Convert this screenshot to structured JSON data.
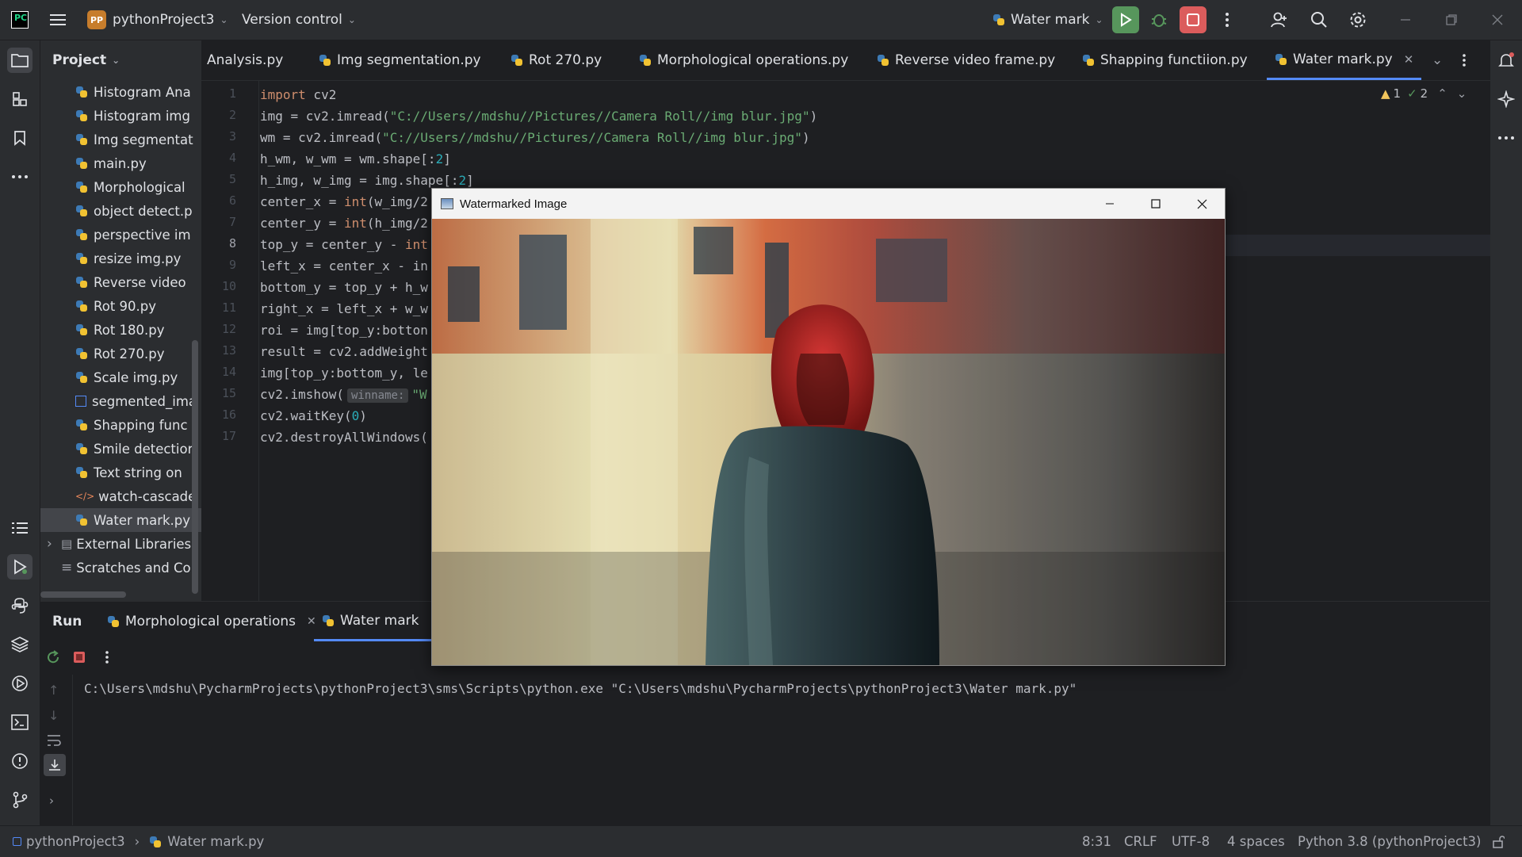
{
  "titlebar": {
    "project_badge": "PP",
    "project_name": "pythonProject3",
    "vcs": "Version control",
    "run_config": "Water mark"
  },
  "project_panel": {
    "title": "Project",
    "items": [
      {
        "label": "Histogram Ana",
        "icon": "python-file-icon"
      },
      {
        "label": "Histogram img",
        "icon": "python-file-icon"
      },
      {
        "label": "Img segmentat",
        "icon": "python-file-icon"
      },
      {
        "label": "main.py",
        "icon": "python-file-icon"
      },
      {
        "label": "Morphological",
        "icon": "python-file-icon"
      },
      {
        "label": "object detect.p",
        "icon": "python-file-icon"
      },
      {
        "label": "perspective im",
        "icon": "python-file-icon"
      },
      {
        "label": "resize img.py",
        "icon": "python-file-icon"
      },
      {
        "label": "Reverse video",
        "icon": "python-file-icon"
      },
      {
        "label": "Rot 90.py",
        "icon": "python-file-icon"
      },
      {
        "label": "Rot 180.py",
        "icon": "python-file-icon"
      },
      {
        "label": "Rot 270.py",
        "icon": "python-file-icon"
      },
      {
        "label": "Scale img.py",
        "icon": "python-file-icon"
      },
      {
        "label": "segmented_ima",
        "icon": "image-file-icon"
      },
      {
        "label": "Shapping func",
        "icon": "python-file-icon"
      },
      {
        "label": "Smile detectior",
        "icon": "python-file-icon"
      },
      {
        "label": "Text string on",
        "icon": "python-file-icon"
      },
      {
        "label": "watch-cascade",
        "icon": "xml-file-icon"
      },
      {
        "label": "Water mark.py",
        "icon": "python-file-icon",
        "selected": true
      },
      {
        "label": "External Libraries",
        "icon": "library-icon"
      },
      {
        "label": "Scratches and Co",
        "icon": "scratches-icon"
      }
    ]
  },
  "editor": {
    "tabs": [
      {
        "label": "Analysis.py"
      },
      {
        "label": "Img segmentation.py"
      },
      {
        "label": "Rot 270.py"
      },
      {
        "label": "Morphological operations.py"
      },
      {
        "label": "Reverse video frame.py"
      },
      {
        "label": "Shapping functiion.py"
      },
      {
        "label": "Water mark.py",
        "active": true
      }
    ],
    "inspections": {
      "warnings": "1",
      "ok": "2"
    },
    "line_numbers": [
      "1",
      "2",
      "3",
      "4",
      "5",
      "6",
      "7",
      "8",
      "9",
      "10",
      "11",
      "12",
      "13",
      "14",
      "15",
      "16",
      "17"
    ],
    "current_line": "8",
    "code": {
      "l1_kw": "import",
      "l1_rest": " cv2",
      "l2_a": "img = cv2.imread(",
      "l2_str": "\"C://Users//mdshu//Pictures//Camera Roll//img blur.jpg\"",
      "l2_b": ")",
      "l3_a": "wm = cv2.imread(",
      "l3_str": "\"C://Users//mdshu//Pictures//Camera Roll//img blur.jpg\"",
      "l3_b": ")",
      "l4_a": "h_wm, w_wm = wm.shape[:",
      "l4_num": "2",
      "l4_b": "]",
      "l5_a": "h_img, w_img = img.shape[:",
      "l5_num": "2",
      "l5_b": "]",
      "l6_a": "center_x = ",
      "l6_kw": "int",
      "l6_b": "(w_img/2",
      "l7_a": "center_y = ",
      "l7_kw": "int",
      "l7_b": "(h_img/2",
      "l8_a": "top_y = center_y - ",
      "l8_kw": "int",
      "l9": "left_x = center_x - in",
      "l10": "bottom_y = top_y + h_w",
      "l11": "right_x = left_x + w_w",
      "l12": "roi = img[top_y:botton",
      "l13": "result = cv2.addWeight",
      "l14": "img[top_y:bottom_y, le",
      "l15_a": "cv2.imshow(",
      "l15_hint": "winname:",
      "l15_str": "\"W",
      "l16_a": "cv2.waitKey(",
      "l16_num": "0",
      "l16_b": ")",
      "l17": "cv2.destroyAllWindows("
    }
  },
  "run_panel": {
    "title": "Run",
    "tabs": [
      {
        "label": "Morphological operations"
      },
      {
        "label": "Water mark",
        "active": true
      }
    ],
    "console_line": "C:\\Users\\mdshu\\PycharmProjects\\pythonProject3\\sms\\Scripts\\python.exe \"C:\\Users\\mdshu\\PycharmProjects\\pythonProject3\\Water mark.py\""
  },
  "image_window": {
    "title": "Watermarked Image"
  },
  "statusbar": {
    "crumb_project": "pythonProject3",
    "crumb_file": "Water mark.py",
    "position": "8:31",
    "line_sep": "CRLF",
    "encoding": "UTF-8",
    "indent": "4 spaces",
    "interpreter": "Python 3.8 (pythonProject3)"
  },
  "colors": {
    "accent": "#548af7",
    "run_green": "#57965c",
    "stop_red": "#db5c5c",
    "keyword": "#cf8e6d",
    "string": "#6aab73",
    "number": "#2aacb8"
  }
}
